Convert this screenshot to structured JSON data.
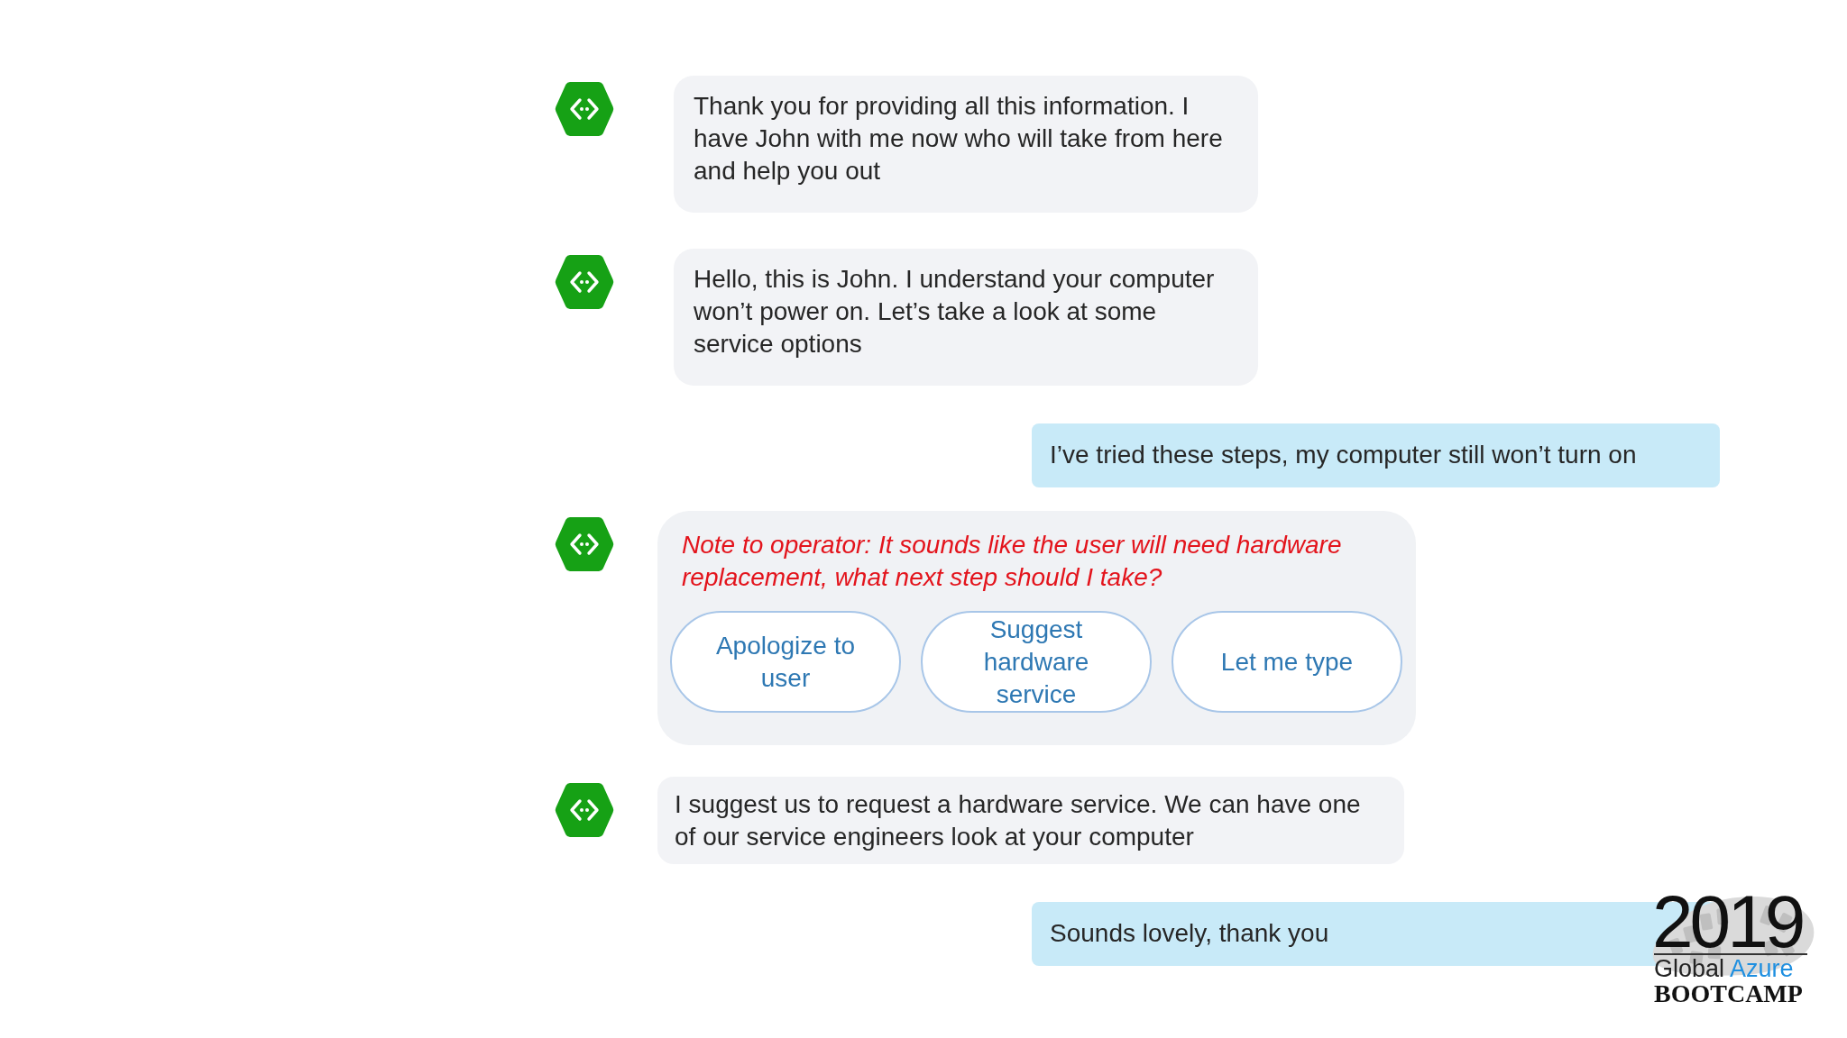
{
  "messages": [
    {
      "kind": "bot",
      "text": "Thank you for providing all this information. I have John with me now who will take from here and help you out"
    },
    {
      "kind": "bot",
      "text": "Hello, this is John. I understand your computer won’t power on. Let’s take a look at some service options"
    },
    {
      "kind": "user",
      "text": "I’ve tried these steps, my computer still won’t turn on"
    },
    {
      "kind": "prompt",
      "note": "Note to operator: It sounds like the user will need hardware replacement, what next step should I take?",
      "choices": [
        "Apologize to user",
        "Suggest hardware service",
        "Let me type"
      ]
    },
    {
      "kind": "bot",
      "text": "I suggest us to request a hardware service. We can have one of our service engineers look at your computer"
    },
    {
      "kind": "user",
      "text": "Sounds lovely, thank you"
    }
  ],
  "logo": {
    "year": "2019",
    "name": "Global",
    "name_accent": "Azure",
    "tagline": "BOOTCAMP"
  }
}
